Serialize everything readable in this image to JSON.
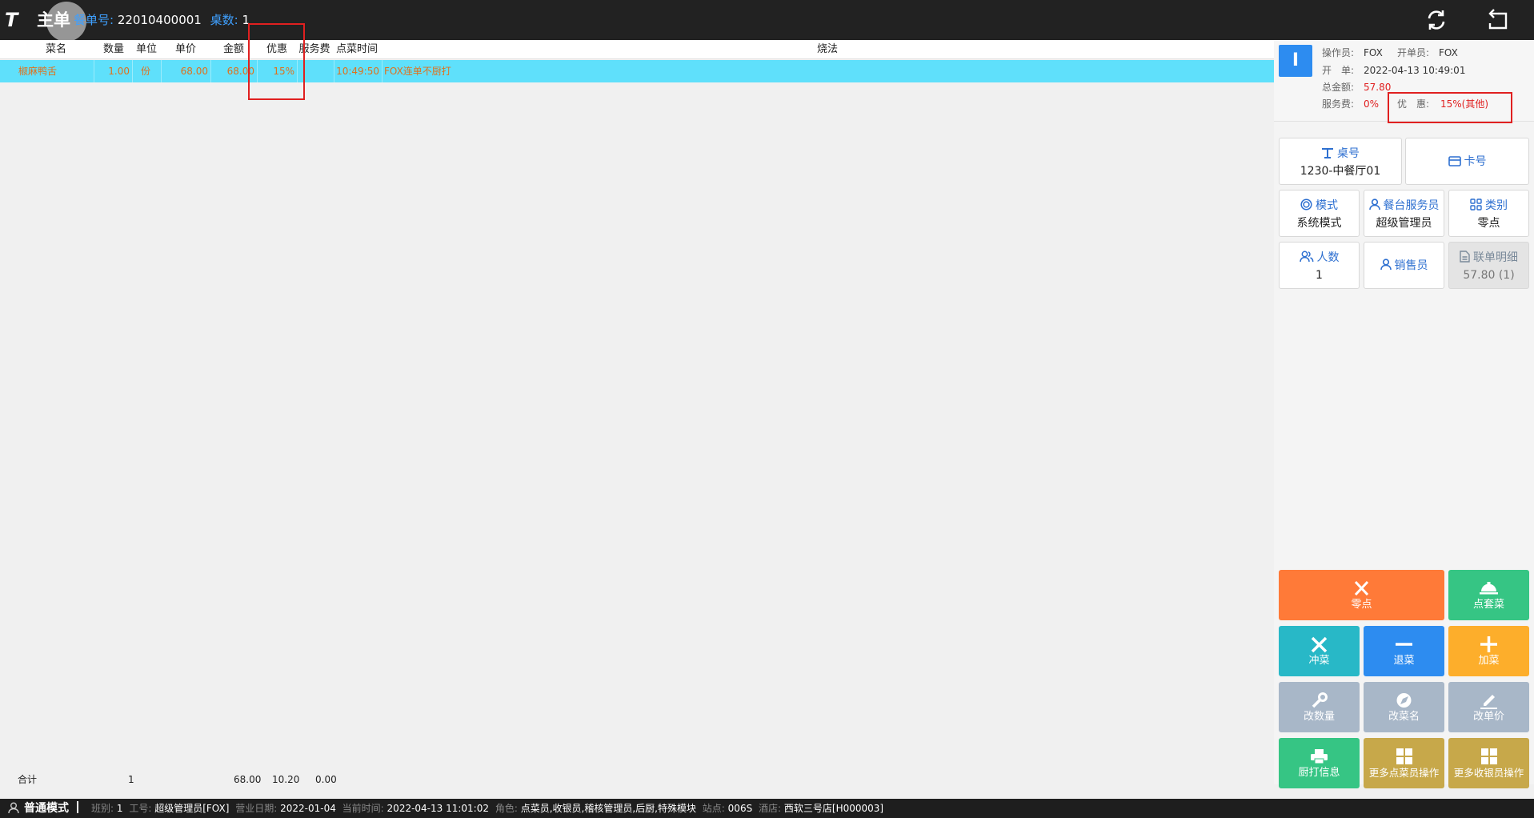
{
  "header": {
    "logo_text": "T",
    "title": "主单",
    "order_no_label": "餐单号:",
    "order_no": "22010400001",
    "tables_label": "桌数:",
    "tables": "1",
    "refresh_icon": "refresh-icon",
    "back_icon": "back-icon"
  },
  "grid": {
    "columns": [
      "菜名",
      "数量",
      "单位",
      "单价",
      "金额",
      "优惠",
      "服务费",
      "点菜时间",
      "烧法"
    ],
    "rows": [
      {
        "name": "椒麻鸭舌",
        "qty": "1.00",
        "unit": "份",
        "price": "68.00",
        "amount": "68.00",
        "discount": "15%",
        "service": "",
        "time": "10:49:50",
        "method": "FOX连单不厨打"
      }
    ],
    "footer": {
      "label": "合计",
      "qty": "1",
      "amount": "68.00",
      "discount": "10.20",
      "service": "0.00"
    }
  },
  "info": {
    "avatar": "I",
    "operator_label": "操作员:",
    "operator": "FOX",
    "opener_label": "开单员:",
    "opener": "FOX",
    "open_label": "开　单:",
    "open_time": "2022-04-13 10:49:01",
    "total_label": "总金额:",
    "total": "57.80",
    "service_label": "服务费:",
    "service": "0%",
    "discount_label": "优　惠:",
    "discount": "15%(其他)"
  },
  "cards": {
    "table": {
      "title": "桌号",
      "value": "1230-中餐厅01"
    },
    "card": {
      "title": "卡号"
    },
    "mode": {
      "title": "模式",
      "value": "系统模式"
    },
    "waiter": {
      "title": "餐台服务员",
      "value": "超级管理员"
    },
    "category": {
      "title": "类别",
      "value": "零点"
    },
    "people": {
      "title": "人数",
      "value": "1"
    },
    "sales": {
      "title": "销售员"
    },
    "linked": {
      "title": "联单明细",
      "value": "57.80 (1)"
    }
  },
  "actions": [
    {
      "label": "零点",
      "color": "#ff7a38",
      "icon": "fork-knife-icon"
    },
    {
      "label": "点套菜",
      "color": "#36c584",
      "icon": "cloche-icon"
    },
    {
      "label": "冲菜",
      "color": "#28b8c7",
      "icon": "cross-icon"
    },
    {
      "label": "退菜",
      "color": "#2d8cf0",
      "icon": "minus-icon"
    },
    {
      "label": "加菜",
      "color": "#fdae2b",
      "icon": "plus-icon"
    },
    {
      "label": "改数量",
      "color": "#a8b7c8",
      "icon": "wrench-icon"
    },
    {
      "label": "改菜名",
      "color": "#a8b7c8",
      "icon": "compass-icon"
    },
    {
      "label": "改单价",
      "color": "#a8b7c8",
      "icon": "pen-icon"
    },
    {
      "label": "厨打信息",
      "color": "#36c584",
      "icon": "printer-icon"
    },
    {
      "label": "更多点菜员操作",
      "color": "#c7a84a",
      "icon": "grid-icon"
    },
    {
      "label": "更多收银员操作",
      "color": "#c7a84a",
      "icon": "grid-icon"
    }
  ],
  "status": {
    "mode": "普通模式",
    "shift_label": "班别:",
    "shift": "1",
    "worker_label": "工号:",
    "worker": "超级管理员[FOX]",
    "bizdate_label": "营业日期:",
    "bizdate": "2022-01-04",
    "now_label": "当前时间:",
    "now": "2022-04-13 11:01:02",
    "role_label": "角色:",
    "role": "点菜员,收银员,稽核管理员,后厨,特殊模块",
    "station_label": "站点:",
    "station": "006S",
    "hotel_label": "酒店:",
    "hotel": "西软三号店[H000003]"
  }
}
